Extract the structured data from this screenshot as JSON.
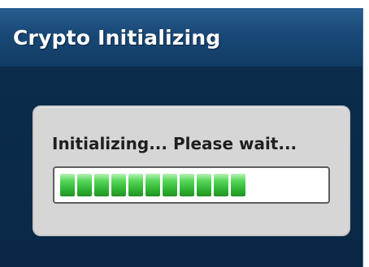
{
  "window": {
    "title": "Crypto Initializing"
  },
  "status": {
    "message": "Initializing... Please wait...",
    "progress_percent": 72,
    "segments_filled": 11
  },
  "colors": {
    "title_bar": "#1a4a78",
    "background": "#0b2c4b",
    "panel": "#d6d6d6",
    "progress_fill": "#43c547"
  }
}
